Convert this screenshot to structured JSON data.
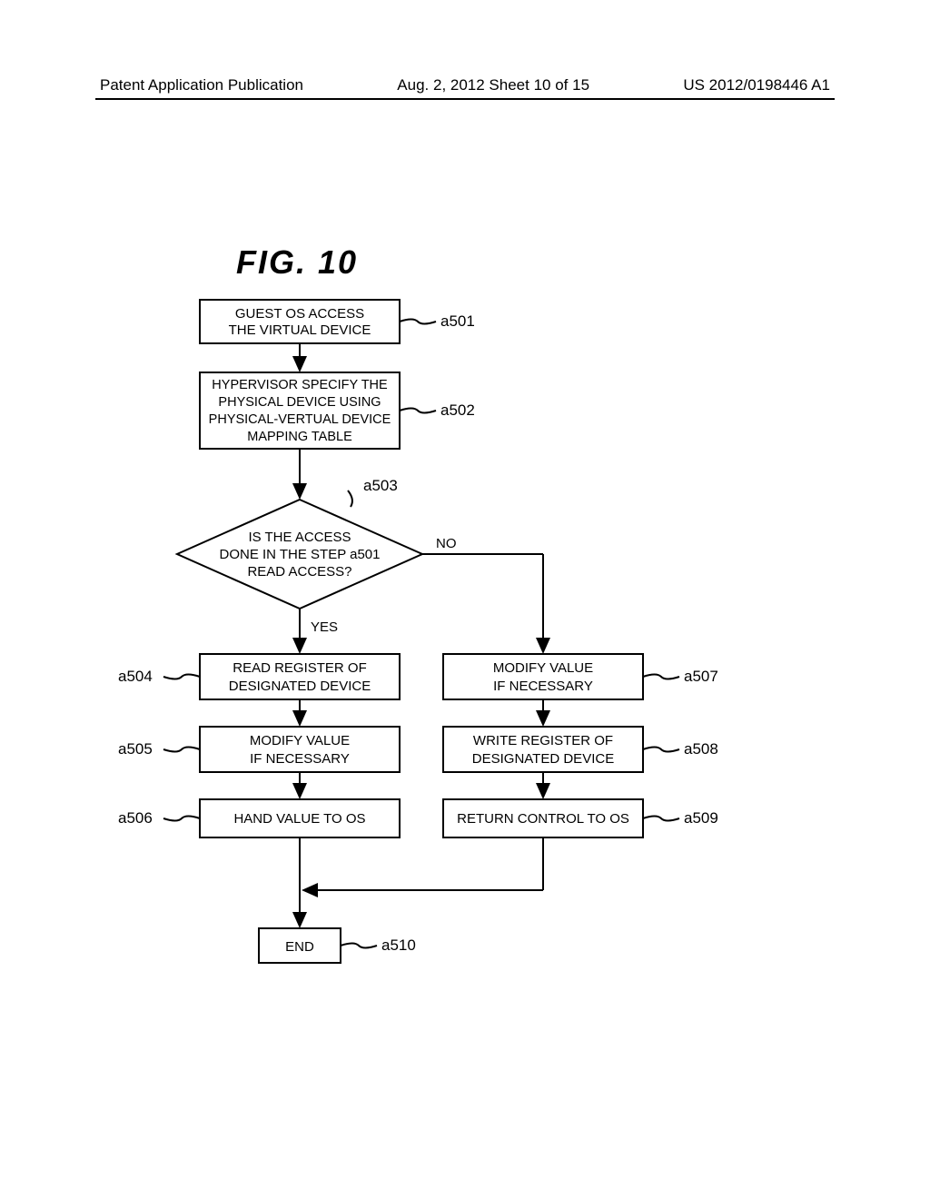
{
  "header": {
    "left": "Patent Application Publication",
    "center": "Aug. 2, 2012  Sheet 10 of 15",
    "right": "US 2012/0198446 A1"
  },
  "figure_title": "FIG.   10",
  "steps": {
    "a501": {
      "label": "a501",
      "text1": "GUEST OS ACCESS",
      "text2": "THE VIRTUAL DEVICE"
    },
    "a502": {
      "label": "a502",
      "text1": "HYPERVISOR SPECIFY THE",
      "text2": "PHYSICAL DEVICE USING",
      "text3": "PHYSICAL-VERTUAL DEVICE",
      "text4": "MAPPING TABLE"
    },
    "a503": {
      "label": "a503",
      "text1": "IS THE ACCESS",
      "text2": "DONE IN THE STEP a501",
      "text3": "READ ACCESS?"
    },
    "a504": {
      "label": "a504",
      "text1": "READ REGISTER OF",
      "text2": "DESIGNATED DEVICE"
    },
    "a505": {
      "label": "a505",
      "text1": "MODIFY VALUE",
      "text2": "IF NECESSARY"
    },
    "a506": {
      "label": "a506",
      "text1": "HAND VALUE TO OS"
    },
    "a507": {
      "label": "a507",
      "text1": "MODIFY VALUE",
      "text2": "IF NECESSARY"
    },
    "a508": {
      "label": "a508",
      "text1": "WRITE REGISTER OF",
      "text2": "DESIGNATED DEVICE"
    },
    "a509": {
      "label": "a509",
      "text1": "RETURN CONTROL TO OS"
    },
    "a510": {
      "label": "a510",
      "text1": "END"
    }
  },
  "branches": {
    "yes": "YES",
    "no": "NO"
  }
}
